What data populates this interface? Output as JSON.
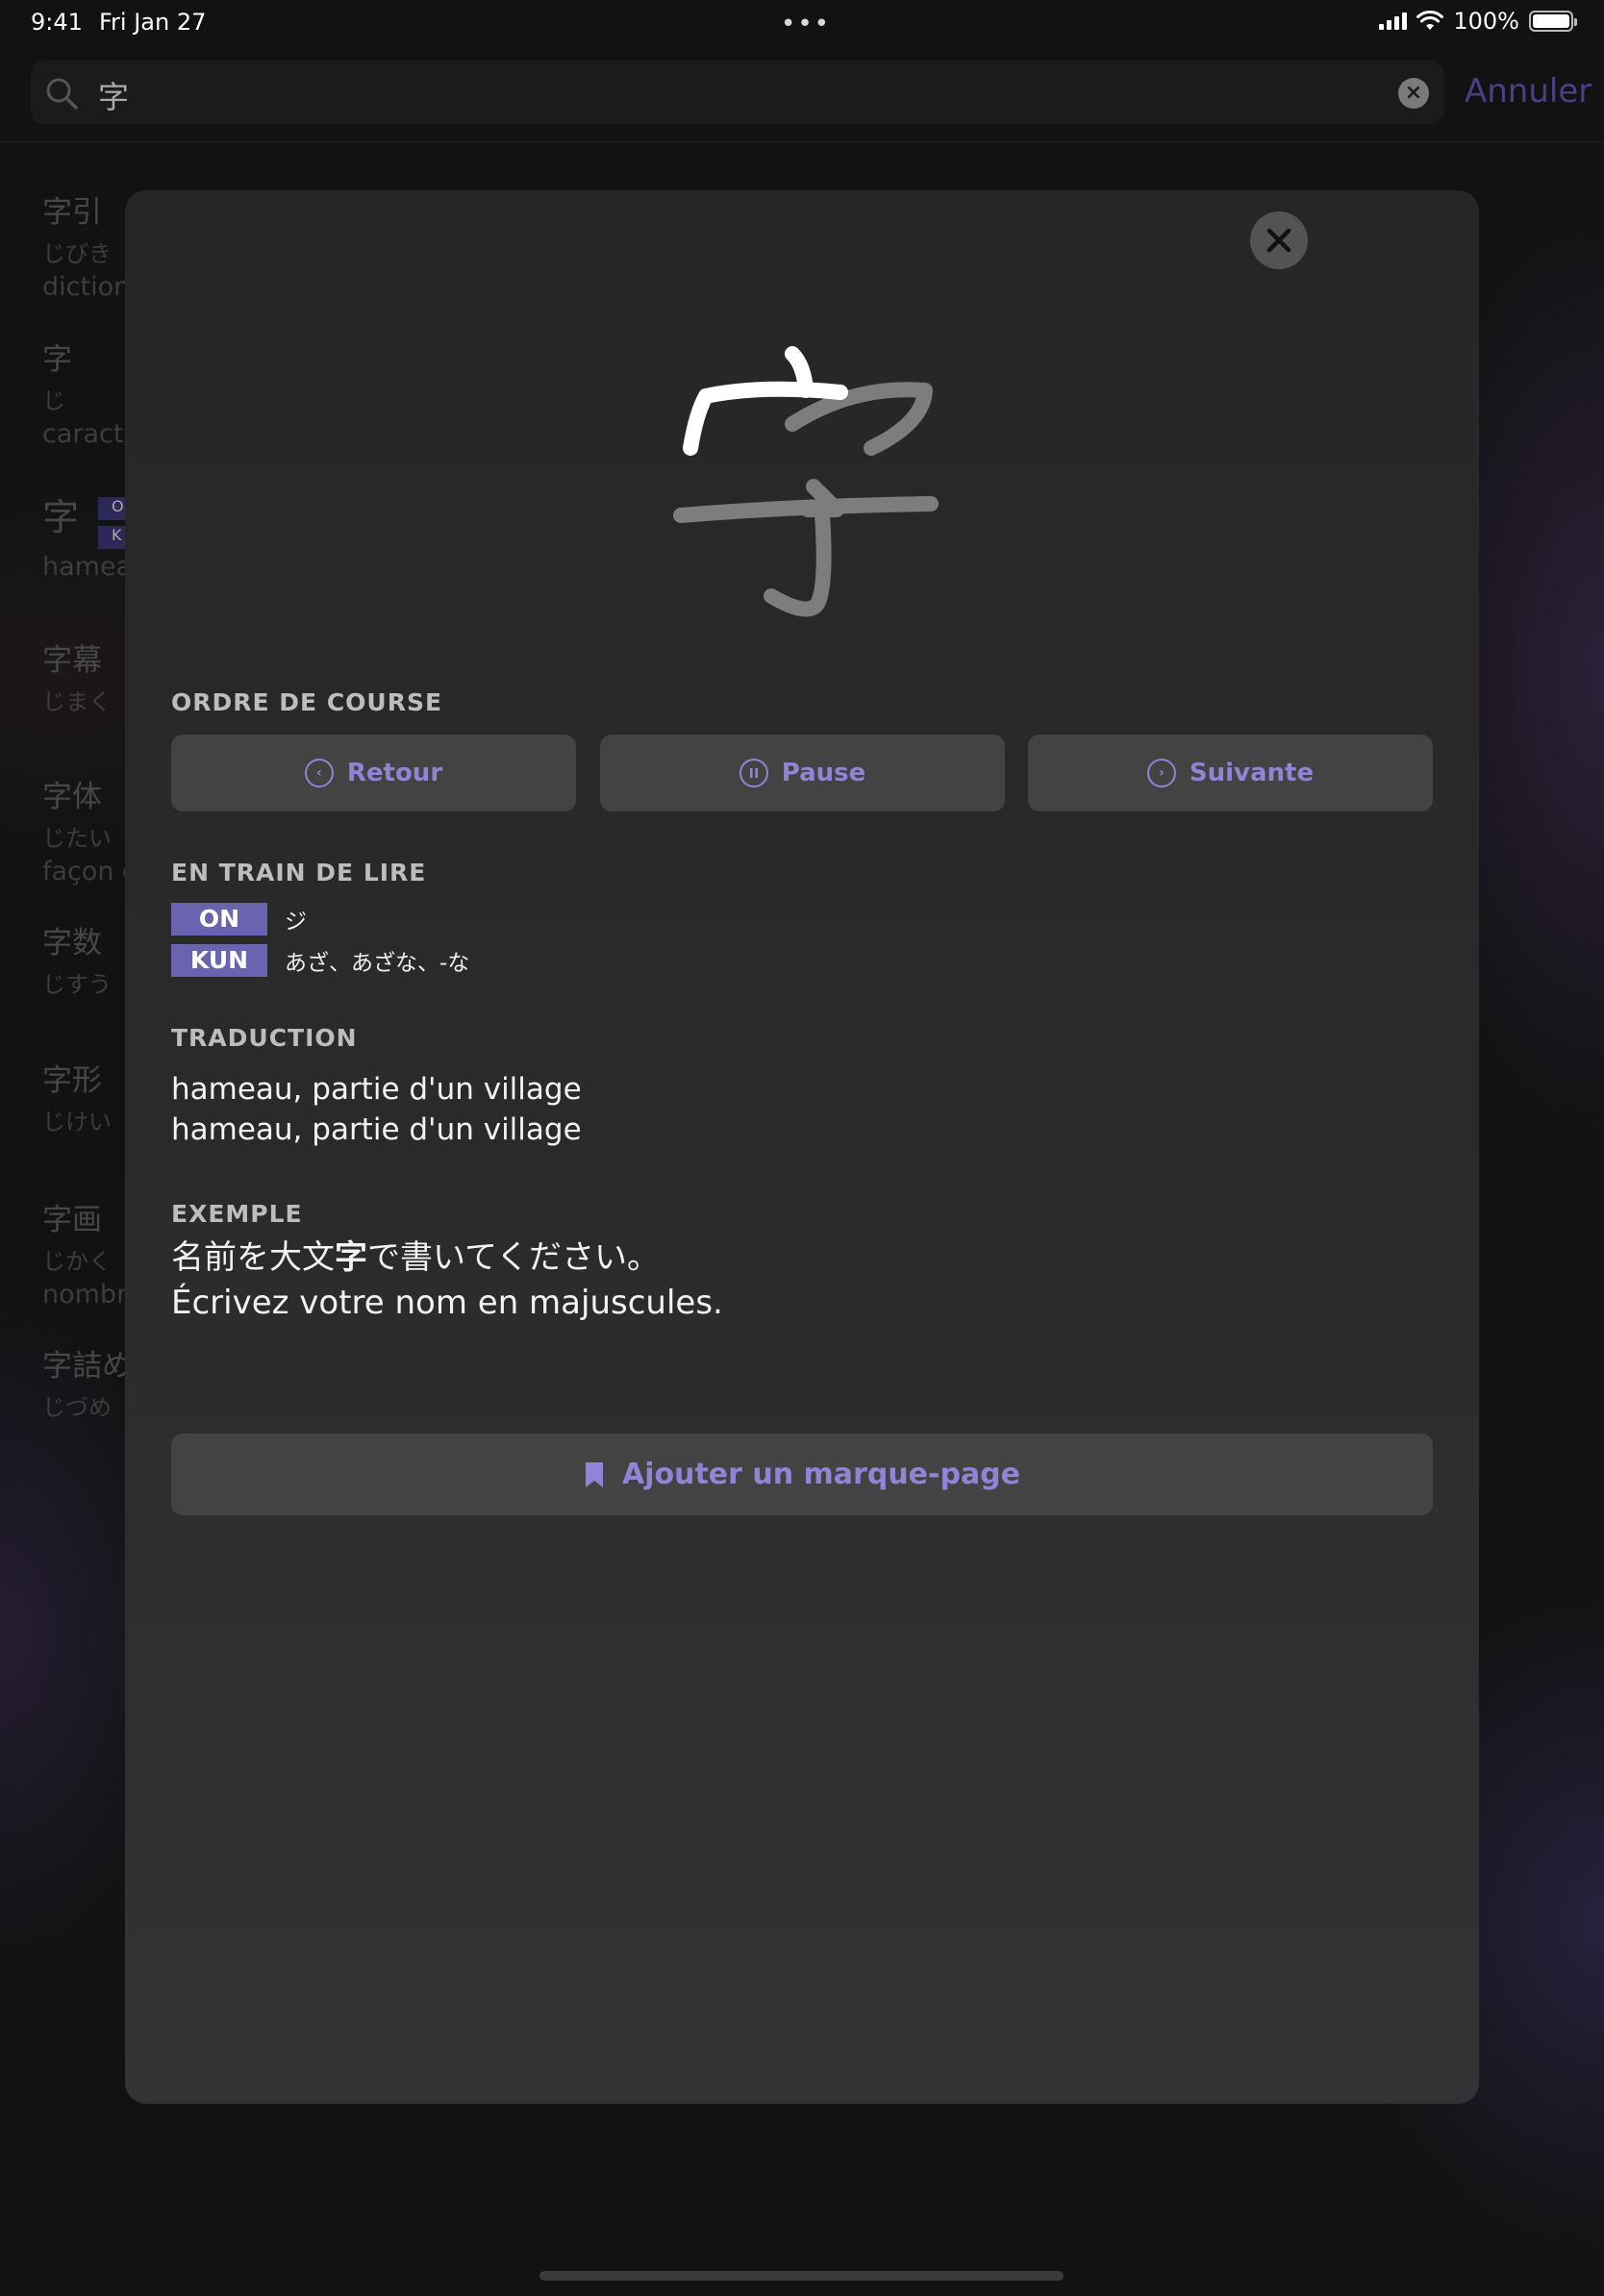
{
  "status_bar": {
    "time": "9:41",
    "date": "Fri Jan 27",
    "dots": "•••",
    "battery": "100%"
  },
  "search": {
    "query": "字",
    "cancel_label": "Annuler"
  },
  "list_items": [
    {
      "kanji": "字引",
      "reading": "じびき",
      "meaning": "dictionnaire"
    },
    {
      "kanji": "字",
      "reading": "じ",
      "meaning": "caractère"
    },
    {
      "kanji": "字",
      "reading": "",
      "meaning": "hameau",
      "tags": [
        "O",
        "K"
      ]
    },
    {
      "kanji": "字幕",
      "reading": "じまく",
      "meaning": ""
    },
    {
      "kanji": "字体",
      "reading": "じたい",
      "meaning": "façon d"
    },
    {
      "kanji": "字数",
      "reading": "じすう",
      "meaning": ""
    },
    {
      "kanji": "字形",
      "reading": "じけい",
      "meaning": ""
    },
    {
      "kanji": "字画",
      "reading": "じかく",
      "meaning": "nombre"
    },
    {
      "kanji": "字詰め",
      "reading": "じづめ",
      "meaning": ""
    }
  ],
  "modal": {
    "stroke_order_label": "ORDRE DE COURSE",
    "buttons": {
      "back": "Retour",
      "pause": "Pause",
      "next": "Suivante"
    },
    "readings_label": "EN TRAIN DE LIRE",
    "readings": [
      {
        "tag": "ON",
        "value": "ジ"
      },
      {
        "tag": "KUN",
        "value": "あざ、あざな、-な"
      }
    ],
    "translation_label": "TRADUCTION",
    "translations": [
      "hameau, partie d'un village",
      "hameau, partie d'un village"
    ],
    "example_label": "EXEMPLE",
    "example_jp_pre": "名前を大文",
    "example_jp_kanji": "字",
    "example_jp_post": "で書いてください。",
    "example_fr": "Écrivez votre nom en majuscules.",
    "bookmark_label": "Ajouter un marque-page"
  },
  "colors": {
    "accent": "#8f84d6",
    "tag_bg": "#6a63b0",
    "button_bg": "#434343"
  }
}
